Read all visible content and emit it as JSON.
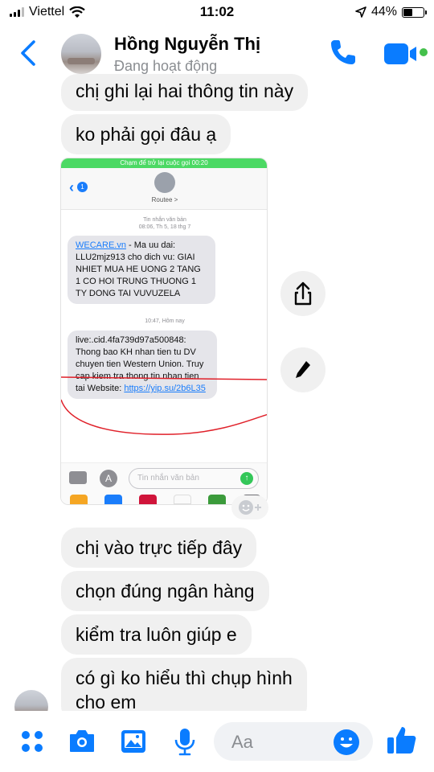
{
  "status_bar": {
    "carrier": "Viettel",
    "time": "11:02",
    "battery_percent": "44%",
    "battery_level": 0.44
  },
  "header": {
    "contact_name": "Hồng Nguyễn Thị",
    "contact_status": "Đang hoạt động",
    "icons": [
      "back-chevron-icon",
      "phone-icon",
      "video-camera-icon"
    ]
  },
  "messages": [
    {
      "text": "chị ghi lại hai thông tin này"
    },
    {
      "text": "ko phải gọi đâu ạ"
    },
    {
      "text": "chị vào trực tiếp đây"
    },
    {
      "text": "chọn đúng ngân hàng"
    },
    {
      "text": "kiểm tra luôn giúp e"
    },
    {
      "text_line1": "có gì ko hiểu thì chụp hình",
      "text_line2": "cho em"
    }
  ],
  "shared_screenshot": {
    "banner": "Chạm để trở lại cuộc gọi 00:20",
    "back_badge": "1",
    "contact": "Routee >",
    "stamp1_line1": "Tin nhắn văn bản",
    "stamp1_line2": "08:06, Th 5, 18 thg 7",
    "sms1_link": "WECARE.vn",
    "sms1_text": " - Ma uu dai: LLU2mjz913 cho dich vu: GIAI NHIET MUA HE UONG 2 TANG 1 CO HOI TRUNG THUONG 1 TY DONG TAI VUVUZELA",
    "stamp2": "10:47, Hôm nay",
    "sms2_text": "live:.cid.4fa739d97a500848: Thong bao KH nhan tien tu DV chuyen tien Western Union. Truy cap kiem tra thong tin nhan tien tai Website: ",
    "sms2_link": "https://yip.su/2b6L35",
    "input_placeholder": "Tin nhắn văn bản"
  },
  "composer": {
    "placeholder": "Aa",
    "icons": [
      "apps-grid-icon",
      "camera-icon",
      "gallery-icon",
      "microphone-icon",
      "emoji-icon",
      "thumbs-up-icon"
    ]
  },
  "colors": {
    "accent": "#0a7cff",
    "bubble": "#f0f0f0",
    "online": "#44c04b",
    "ios_link": "#1a7dfb",
    "annotation_red": "#e0212a"
  }
}
